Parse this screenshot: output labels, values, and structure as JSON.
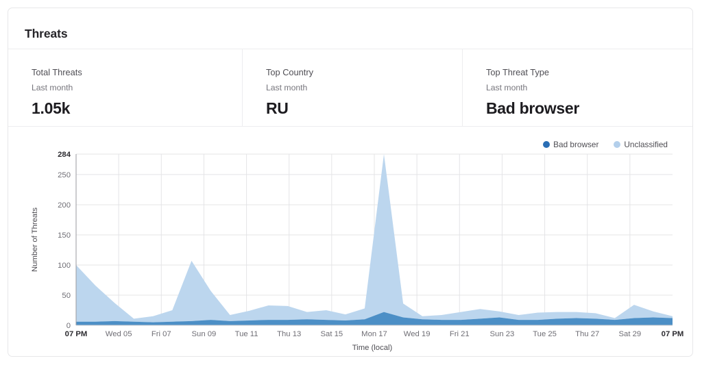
{
  "card": {
    "title": "Threats"
  },
  "stats": [
    {
      "label": "Total Threats",
      "sub": "Last month",
      "value": "1.05k"
    },
    {
      "label": "Top Country",
      "sub": "Last month",
      "value": "RU"
    },
    {
      "label": "Top Threat Type",
      "sub": "Last month",
      "value": "Bad browser"
    }
  ],
  "legend": [
    {
      "label": "Bad browser",
      "color": "#2a6eb5"
    },
    {
      "label": "Unclassified",
      "color": "#b3cfeb"
    }
  ],
  "chart_data": {
    "type": "area",
    "stacked": true,
    "title": "",
    "xlabel": "Time (local)",
    "ylabel": "Number of Threats",
    "ylim": [
      0,
      284
    ],
    "yticks": [
      0,
      50,
      100,
      150,
      200,
      250,
      284
    ],
    "ytick_labels": [
      "0",
      "50",
      "100",
      "150",
      "200",
      "250",
      "284"
    ],
    "grid": true,
    "legend_position": "top-right",
    "xtick_labels": [
      "07 PM",
      "Wed 05",
      "Fri 07",
      "Sun 09",
      "Tue 11",
      "Thu 13",
      "Sat 15",
      "Mon 17",
      "Wed 19",
      "Fri 21",
      "Sun 23",
      "Tue 25",
      "Thu 27",
      "Sat 29",
      "07 PM"
    ],
    "x": [
      0,
      1,
      2,
      3,
      4,
      5,
      6,
      7,
      8,
      9,
      10,
      11,
      12,
      13,
      14,
      15,
      16,
      17,
      18,
      19,
      20,
      21,
      22,
      23,
      24,
      25,
      26,
      27,
      28,
      29,
      30,
      31
    ],
    "series": [
      {
        "name": "Bad browser",
        "color": "#4c8fc6",
        "values": [
          6,
          6,
          7,
          6,
          5,
          6,
          7,
          9,
          7,
          8,
          9,
          9,
          10,
          9,
          8,
          10,
          22,
          13,
          10,
          9,
          9,
          11,
          13,
          9,
          9,
          11,
          12,
          11,
          9,
          12,
          13,
          12
        ]
      },
      {
        "name": "Unclassified",
        "color": "#bcd6ee",
        "values": [
          94,
          60,
          30,
          5,
          10,
          19,
          100,
          48,
          10,
          16,
          24,
          23,
          12,
          16,
          10,
          18,
          262,
          23,
          5,
          8,
          13,
          16,
          10,
          8,
          12,
          11,
          10,
          9,
          3,
          22,
          10,
          3
        ]
      }
    ]
  }
}
